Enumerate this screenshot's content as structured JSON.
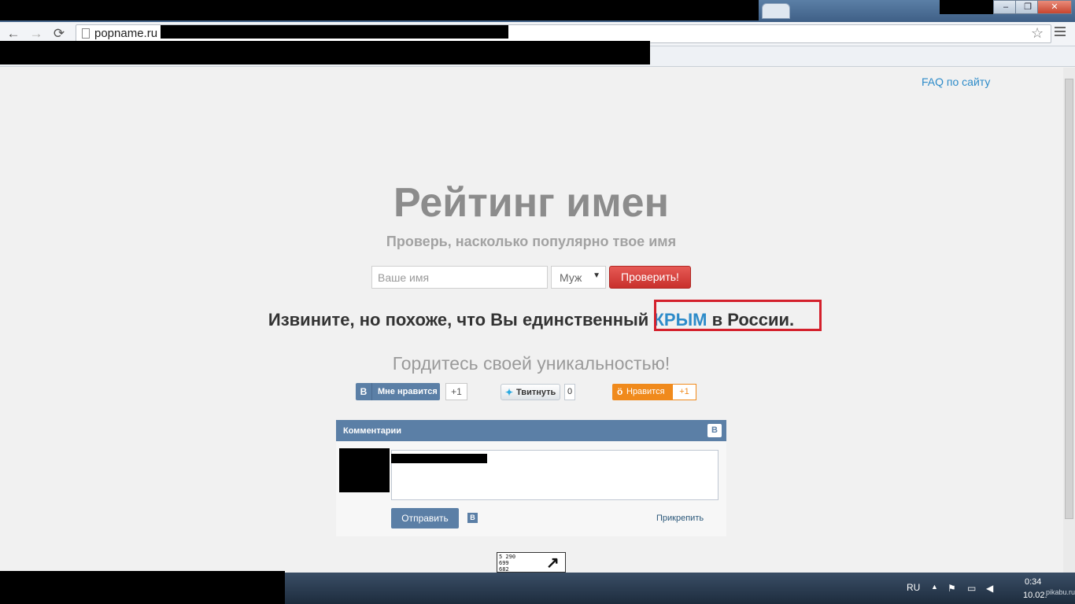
{
  "browser": {
    "url": "popname.ru",
    "window_controls": {
      "minimize": "–",
      "maximize": "❐",
      "close": "✕"
    },
    "nav": {
      "back": "←",
      "forward": "→",
      "reload": "⟳"
    },
    "star": "☆"
  },
  "page": {
    "faq_link": "FAQ по сайту",
    "title": "Рейтинг имен",
    "subtitle": "Проверь, насколько популярно твое имя",
    "form": {
      "name_placeholder": "Ваше имя",
      "gender_selected": "Муж",
      "submit_label": "Проверить!"
    },
    "result": {
      "prefix": "Извините, но похоже, что Вы единственный",
      "name": "КРЫМ",
      "suffix": "в России."
    },
    "pride": "Гордитесь своей уникальностью!",
    "social": {
      "vk_logo": "B",
      "vk_like_label": "Мне нравится",
      "vk_like_count": "+1",
      "tweet_label": "Твитнуть",
      "tweet_count": "0",
      "ok_icon": "ӧ",
      "ok_label": "Нравится",
      "ok_count": "+1"
    },
    "comments": {
      "header": "Комментарии",
      "vk_logo": "B",
      "send_label": "Отправить",
      "attach_label": "Прикрепить"
    },
    "counter": {
      "lines": "5 290\n699\n682"
    }
  },
  "taskbar": {
    "language": "RU",
    "tray_arrow": "▲",
    "time": "0:34",
    "date": "10.02.",
    "watermark": "pikabu.ru"
  },
  "colors": {
    "accent": "#2d8bc9",
    "button_red": "#d0342f",
    "vk_blue": "#5b7fa6",
    "highlight_red": "#d4202c",
    "ok_orange": "#f08a1c"
  }
}
